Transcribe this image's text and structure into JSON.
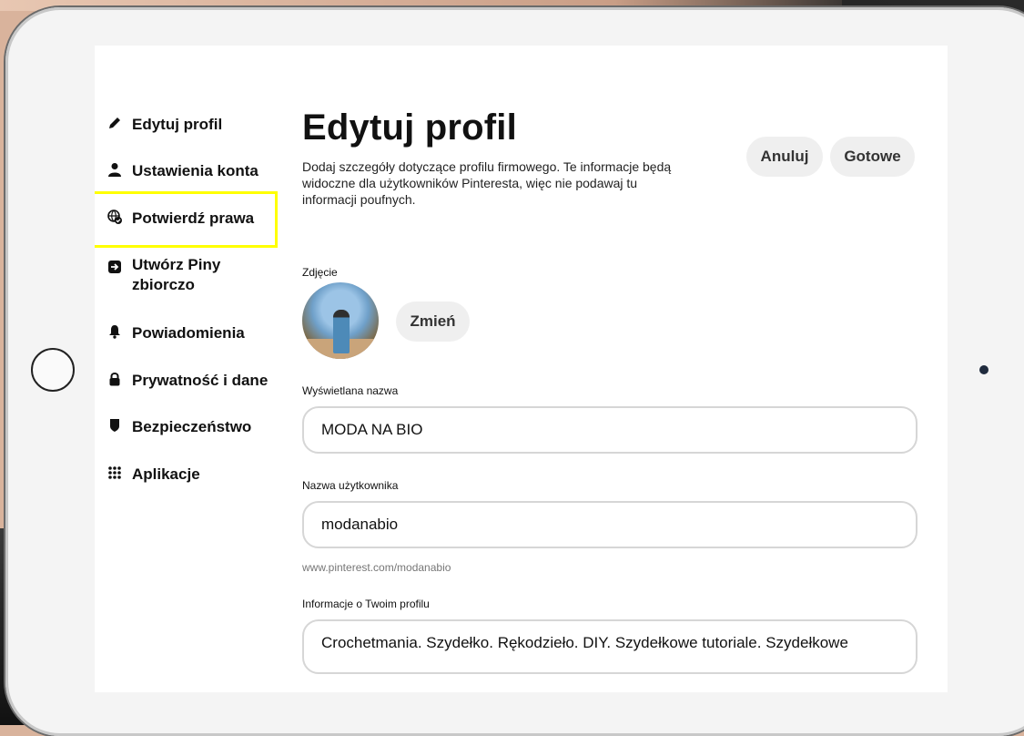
{
  "nav": {
    "items": [
      {
        "label": "Edytuj profil",
        "icon": "pencil-icon",
        "active": true
      },
      {
        "label": "Ustawienia konta",
        "icon": "user-icon"
      },
      {
        "label": "Potwierdź prawa",
        "icon": "globe-check-icon",
        "highlighted": true
      },
      {
        "label": "Utwórz Piny zbiorczo",
        "icon": "import-icon"
      },
      {
        "label": "Powiadomienia",
        "icon": "bell-icon"
      },
      {
        "label": "Prywatność i dane",
        "icon": "lock-icon"
      },
      {
        "label": "Bezpieczeństwo",
        "icon": "shield-icon"
      },
      {
        "label": "Aplikacje",
        "icon": "grid-dots-icon"
      }
    ],
    "highlight_color": "#ffff00"
  },
  "header": {
    "title": "Edytuj profil",
    "description": "Dodaj szczegóły dotyczące profilu firmowego. Te informacje będą widoczne dla użytkowników Pinteresta, więc nie podawaj tu informacji poufnych.",
    "cancel_label": "Anuluj",
    "done_label": "Gotowe"
  },
  "photo": {
    "label": "Zdjęcie",
    "change_label": "Zmień"
  },
  "display_name": {
    "label": "Wyświetlana nazwa",
    "value": "MODA NA BIO"
  },
  "username": {
    "label": "Nazwa użytkownika",
    "value": "modanabio",
    "helper": "www.pinterest.com/modanabio"
  },
  "about": {
    "label": "Informacje o Twoim profilu",
    "value": "Crochetmania. Szydełko. Rękodzieło. DIY. Szydełkowe tutoriale. Szydełkowe"
  }
}
